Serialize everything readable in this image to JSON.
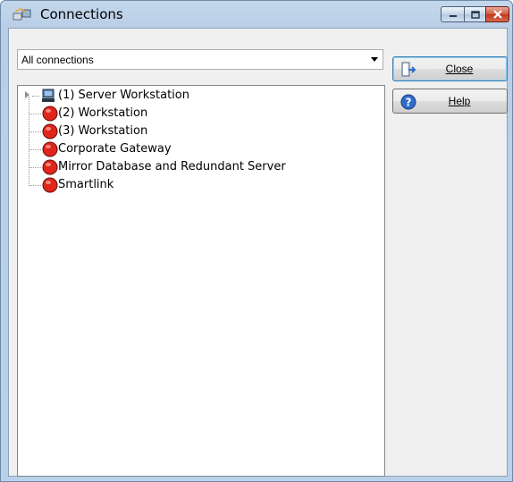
{
  "window": {
    "title": "Connections"
  },
  "filter": {
    "selected": "All connections"
  },
  "tree": {
    "items": [
      {
        "label": "(1)  Server Workstation",
        "icon": "computer-icon",
        "expandable": true
      },
      {
        "label": "(2)  Workstation",
        "icon": "red-status-icon"
      },
      {
        "label": "(3)  Workstation",
        "icon": "red-status-icon"
      },
      {
        "label": "Corporate Gateway",
        "icon": "red-status-icon"
      },
      {
        "label": "Mirror Database and Redundant Server",
        "icon": "red-status-icon"
      },
      {
        "label": "Smartlink",
        "icon": "red-status-icon"
      }
    ]
  },
  "buttons": {
    "close": "Close",
    "help": "Help"
  },
  "colors": {
    "status_red": "#e0261b",
    "accent_blue": "#3c7fb1"
  }
}
